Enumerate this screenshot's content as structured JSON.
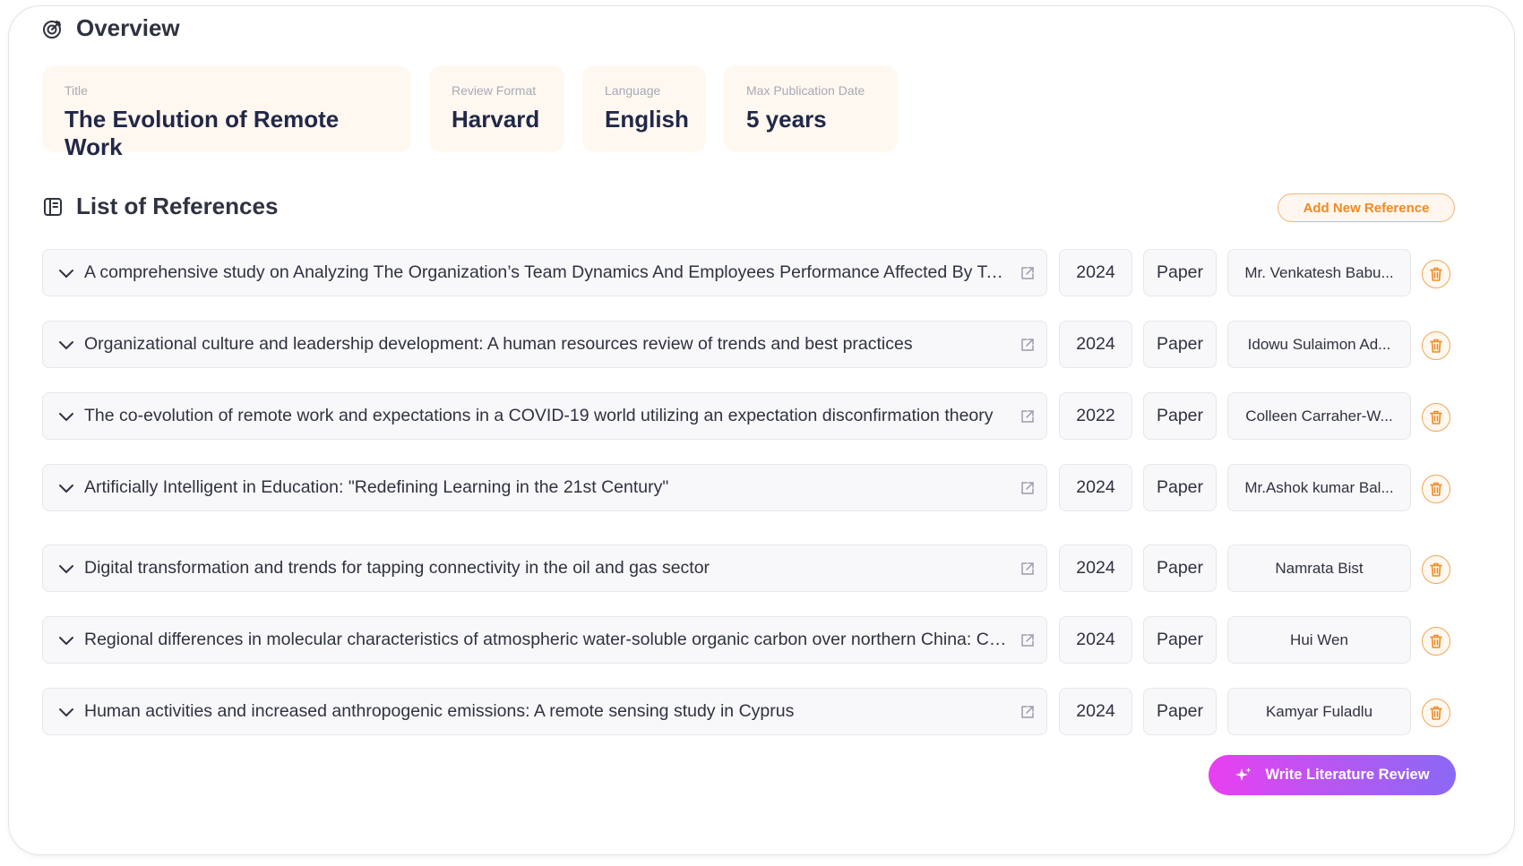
{
  "overview": {
    "heading": "Overview",
    "icon": "target-icon",
    "fields": [
      {
        "label": "Title",
        "value": "The Evolution of Remote Work"
      },
      {
        "label": "Review Format",
        "value": "Harvard"
      },
      {
        "label": "Language",
        "value": "English"
      },
      {
        "label": "Max Publication Date",
        "value": "5 years"
      }
    ]
  },
  "references": {
    "heading": "List of References",
    "icon": "book-icon",
    "add_button_label": "Add New Reference",
    "items": [
      {
        "title": "A comprehensive study on Analyzing The Organization’s Team Dynamics And Employees Performance Affected By Team Leaders",
        "year": "2024",
        "type": "Paper",
        "author": "Mr. Venkatesh Babu..."
      },
      {
        "title": "Organizational culture and leadership development: A human resources review of trends and best practices",
        "year": "2024",
        "type": "Paper",
        "author": "Idowu Sulaimon Ad..."
      },
      {
        "title": "The co-evolution of remote work and expectations in a COVID-19 world utilizing an expectation disconfirmation theory",
        "year": "2022",
        "type": "Paper",
        "author": "Colleen Carraher-W..."
      },
      {
        "title": "Artificially Intelligent in Education: \"Redefining Learning in the 21st Century\"",
        "year": "2024",
        "type": "Paper",
        "author": "Mr.Ashok kumar Bal..."
      },
      {
        "title": "Digital transformation and trends for tapping connectivity in the oil and gas sector",
        "year": "2024",
        "type": "Paper",
        "author": "Namrata Bist"
      },
      {
        "title": "Regional differences in molecular characteristics of atmospheric water-soluble organic carbon over northern China: Comparison",
        "year": "2024",
        "type": "Paper",
        "author": "Hui Wen"
      },
      {
        "title": "Human activities and increased anthropogenic emissions: A remote sensing study in Cyprus",
        "year": "2024",
        "type": "Paper",
        "author": "Kamyar Fuladlu"
      }
    ]
  },
  "actions": {
    "write_button_label": "Write Literature Review",
    "write_button_icon": "sparkle-icon"
  },
  "colors": {
    "accent_orange": "#f08a24",
    "tile_bg": "#fff8f0",
    "gradient_start": "#e93ff0",
    "gradient_end": "#8b69f4"
  }
}
